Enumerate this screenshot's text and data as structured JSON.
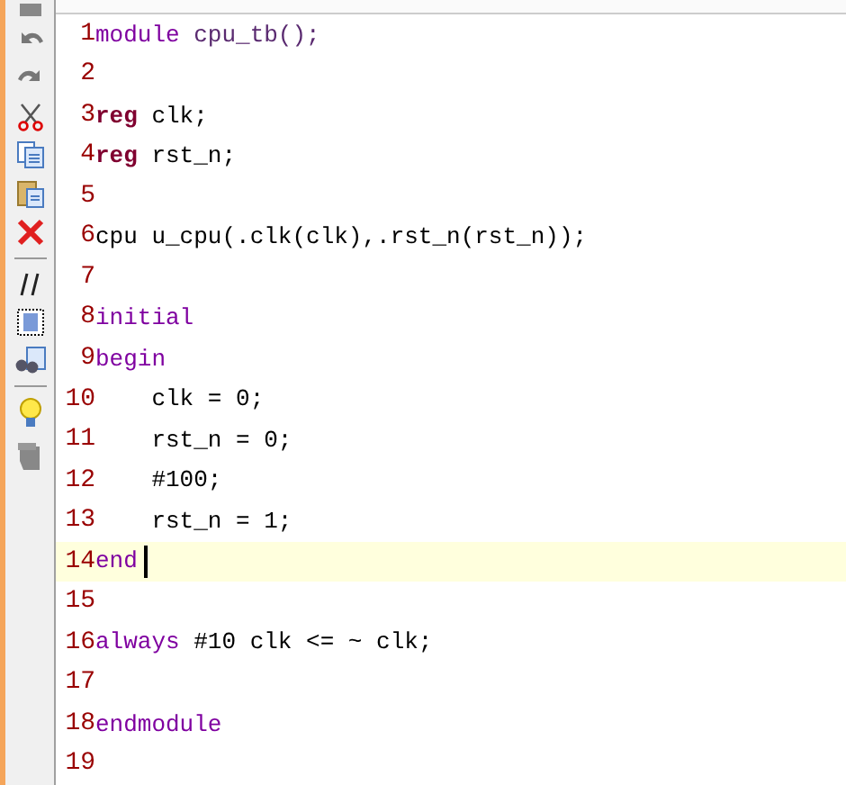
{
  "editor": {
    "lines": [
      {
        "number": "1",
        "current": false,
        "tokens": [
          {
            "text": "module",
            "kind": "keyword"
          },
          {
            "text": " cpu_tb();",
            "kind": "module_name"
          }
        ]
      },
      {
        "number": "2",
        "current": false
      },
      {
        "number": "3",
        "current": false,
        "tokens": [
          {
            "text": "reg",
            "kind": "type"
          },
          {
            "text": " clk;",
            "kind": "plain"
          }
        ]
      },
      {
        "number": "4",
        "current": false,
        "tokens": [
          {
            "text": "reg",
            "kind": "type"
          },
          {
            "text": " rst_n;",
            "kind": "plain"
          }
        ]
      },
      {
        "number": "5",
        "current": false
      },
      {
        "number": "6",
        "current": false,
        "tokens": [
          {
            "text": "cpu u_cpu(.clk(clk),.rst_n(rst_n));",
            "kind": "plain"
          }
        ]
      },
      {
        "number": "7",
        "current": false
      },
      {
        "number": "8",
        "current": false,
        "tokens": [
          {
            "text": "initial",
            "kind": "keyword"
          }
        ]
      },
      {
        "number": "9",
        "current": false,
        "tokens": [
          {
            "text": "begin",
            "kind": "keyword"
          }
        ]
      },
      {
        "number": "10",
        "current": false,
        "tokens": [
          {
            "text": "    clk = 0;",
            "kind": "plain"
          }
        ]
      },
      {
        "number": "11",
        "current": false,
        "tokens": [
          {
            "text": "    rst_n = 0;",
            "kind": "plain"
          }
        ]
      },
      {
        "number": "12",
        "current": false,
        "tokens": [
          {
            "text": "    #100;",
            "kind": "plain"
          }
        ]
      },
      {
        "number": "13",
        "current": false,
        "tokens": [
          {
            "text": "    rst_n = 1;",
            "kind": "plain"
          }
        ]
      },
      {
        "number": "14",
        "current": true,
        "tokens": [
          {
            "text": "end",
            "kind": "keyword"
          }
        ]
      },
      {
        "number": "15",
        "current": false
      },
      {
        "number": "16",
        "current": false,
        "tokens": [
          {
            "text": "always",
            "kind": "keyword"
          },
          {
            "text": " #10 clk <= ~ clk;",
            "kind": "plain"
          }
        ]
      },
      {
        "number": "17",
        "current": false
      },
      {
        "number": "18",
        "current": false,
        "tokens": [
          {
            "text": "endmodule",
            "kind": "keyword"
          }
        ]
      },
      {
        "number": "19",
        "current": false
      }
    ]
  }
}
